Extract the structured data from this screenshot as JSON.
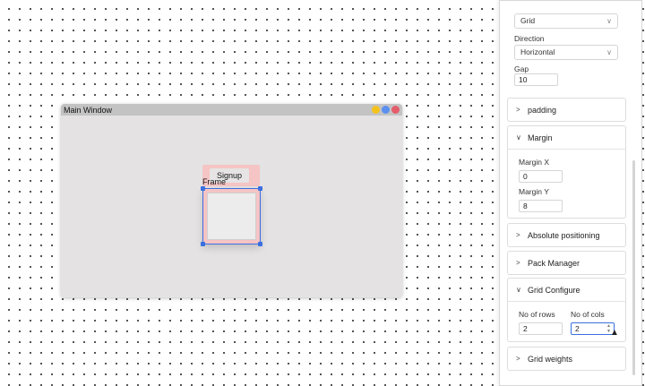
{
  "window": {
    "title": "Main Window",
    "btn_colors": [
      "#f3c21c",
      "#5b8ff0",
      "#e45d6a"
    ]
  },
  "canvas": {
    "signup_label": "Signup",
    "frame_label": "Frame"
  },
  "panel": {
    "layout_select": "Grid",
    "direction_label": "Direction",
    "direction_value": "Horizontal",
    "gap_label": "Gap",
    "gap_value": "10",
    "sections": {
      "padding": "padding",
      "margin": "Margin",
      "absolute": "Absolute positioning",
      "pack": "Pack Manager",
      "grid_configure": "Grid Configure",
      "grid_weights": "Grid weights"
    },
    "margin_x_label": "Margin X",
    "margin_x_value": "0",
    "margin_y_label": "Margin Y",
    "margin_y_value": "8",
    "rows_label": "No of rows",
    "rows_value": "2",
    "cols_label": "No of cols",
    "cols_value": "2"
  },
  "icons": {
    "expand": ">",
    "collapse": "∨",
    "chevron": "∨",
    "spin_up": "▲",
    "spin_down": "▼",
    "cursor": "▲"
  }
}
